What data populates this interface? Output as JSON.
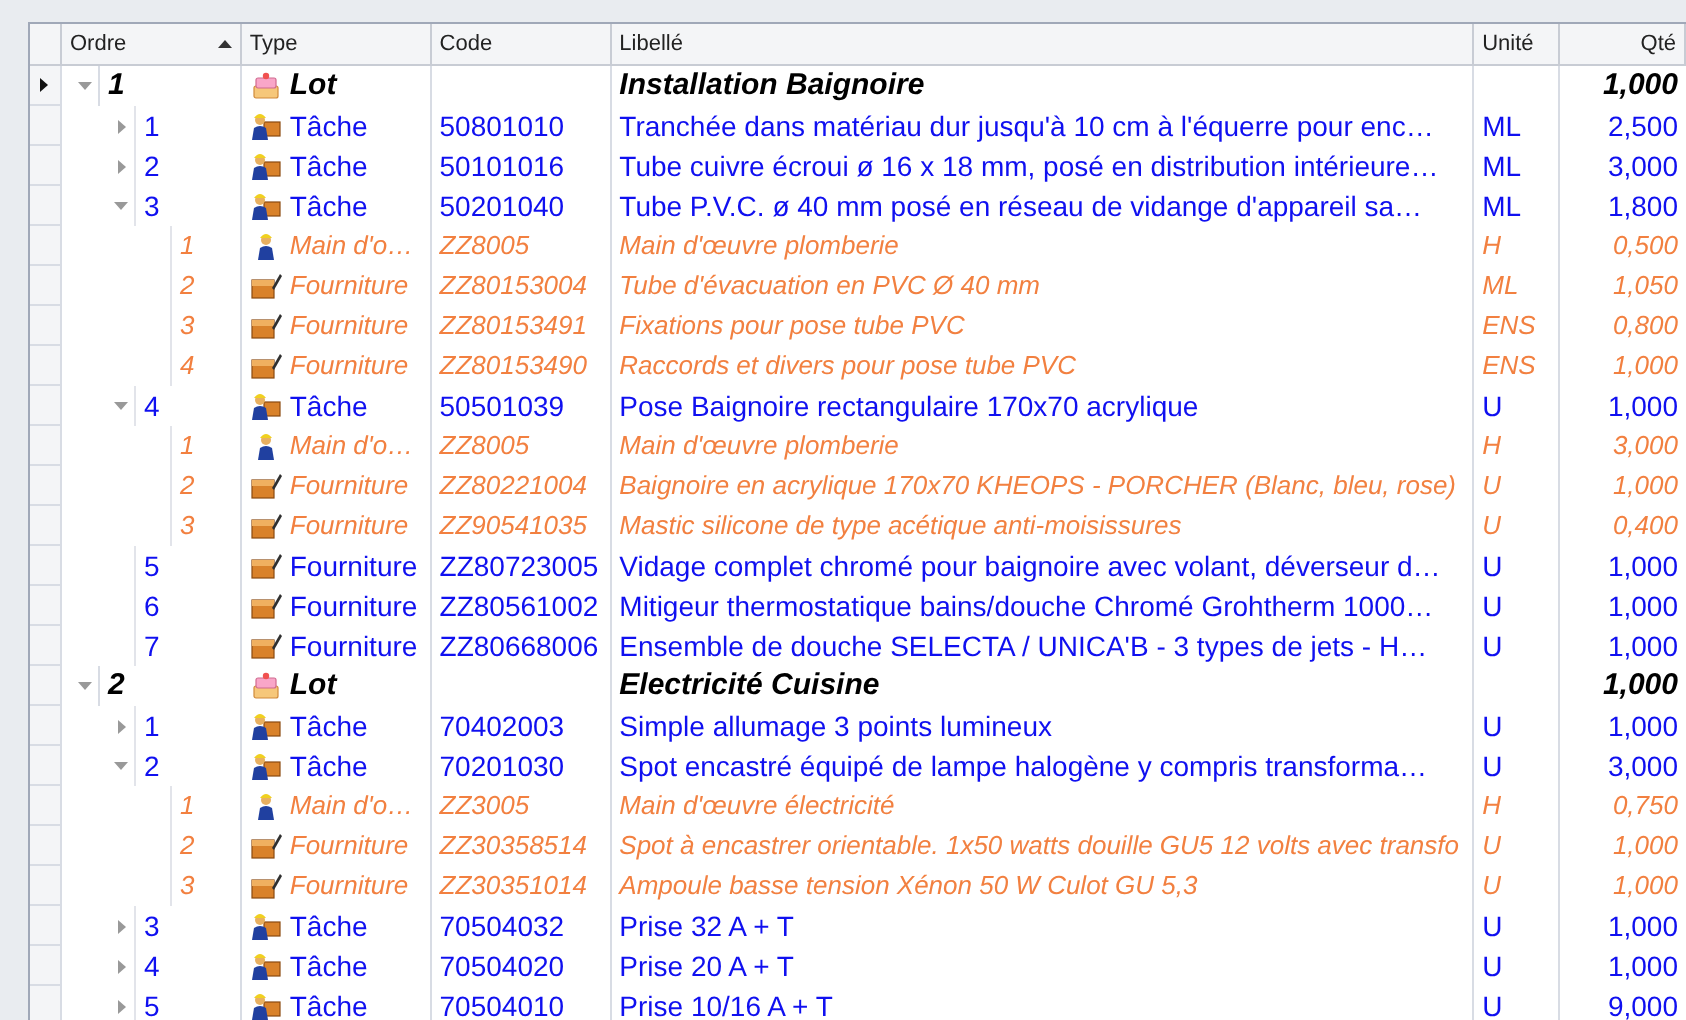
{
  "table": {
    "columns": [
      {
        "label": "Ordre",
        "sorted": true
      },
      {
        "label": "Type",
        "sorted": false
      },
      {
        "label": "Code",
        "sorted": false
      },
      {
        "label": "Libellé",
        "sorted": false
      },
      {
        "label": "Unité",
        "sorted": false
      },
      {
        "label": "Qté",
        "sorted": false
      }
    ],
    "rows": [
      {
        "order": "1",
        "kind": "lot",
        "type": "Lot",
        "label": "Installation Baignoire",
        "qty": "1,000",
        "selected": true,
        "expanded": true,
        "children": [
          {
            "order": "1",
            "kind": "task",
            "type": "Tâche",
            "code": "50801010",
            "label": "Tranchée dans matériau dur jusqu'à 10 cm à l'équerre pour enc…",
            "unit": "ML",
            "qty": "2,500",
            "selected": false,
            "expanded": false
          },
          {
            "order": "2",
            "kind": "task",
            "type": "Tâche",
            "code": "50101016",
            "label": "Tube cuivre écroui ø 16 x 18 mm, posé en distribution intérieure…",
            "unit": "ML",
            "qty": "3,000",
            "selected": false,
            "expanded": false
          },
          {
            "order": "3",
            "kind": "task",
            "type": "Tâche",
            "code": "50201040",
            "label": "Tube P.V.C. ø 40 mm posé en réseau de vidange d'appareil sa…",
            "unit": "ML",
            "qty": "1,800",
            "selected": false,
            "expanded": true,
            "children": [
              {
                "order": "1",
                "kind": "labor",
                "type": "Main d'o…",
                "code": "ZZ8005",
                "label": "Main d'œuvre plomberie",
                "unit": "H",
                "qty": "0,500",
                "selected": false
              },
              {
                "order": "2",
                "kind": "supply",
                "type": "Fourniture",
                "code": "ZZ80153004",
                "label": "Tube d'évacuation en PVC Ø 40 mm",
                "unit": "ML",
                "qty": "1,050",
                "selected": false
              },
              {
                "order": "3",
                "kind": "supply",
                "type": "Fourniture",
                "code": "ZZ80153491",
                "label": "Fixations pour pose tube PVC",
                "unit": "ENS",
                "qty": "0,800",
                "selected": false
              },
              {
                "order": "4",
                "kind": "supply",
                "type": "Fourniture",
                "code": "ZZ80153490",
                "label": "Raccords et divers pour pose tube PVC",
                "unit": "ENS",
                "qty": "1,000",
                "selected": false
              }
            ]
          },
          {
            "order": "4",
            "kind": "task",
            "type": "Tâche",
            "code": "50501039",
            "label": "Pose Baignoire rectangulaire 170x70 acrylique",
            "unit": "U",
            "qty": "1,000",
            "selected": false,
            "expanded": true,
            "children": [
              {
                "order": "1",
                "kind": "labor",
                "type": "Main d'o…",
                "code": "ZZ8005",
                "label": "Main d'œuvre plomberie",
                "unit": "H",
                "qty": "3,000",
                "selected": false
              },
              {
                "order": "2",
                "kind": "supply",
                "type": "Fourniture",
                "code": "ZZ80221004",
                "label": "Baignoire en acrylique 170x70 KHEOPS  - PORCHER (Blanc, bleu, rose)",
                "unit": "U",
                "qty": "1,000",
                "selected": false
              },
              {
                "order": "3",
                "kind": "supply",
                "type": "Fourniture",
                "code": "ZZ90541035",
                "label": "Mastic silicone de type acétique anti-moisissures",
                "unit": "U",
                "qty": "0,400",
                "selected": false
              }
            ]
          },
          {
            "order": "5",
            "kind": "supply",
            "type": "Fourniture",
            "code": "ZZ80723005",
            "label": "Vidage complet chromé pour baignoire avec volant, déverseur d…",
            "unit": "U",
            "qty": "1,000",
            "selected": false
          },
          {
            "order": "6",
            "kind": "supply",
            "type": "Fourniture",
            "code": "ZZ80561002",
            "label": "Mitigeur thermostatique bains/douche Chromé Grohtherm 1000…",
            "unit": "U",
            "qty": "1,000",
            "selected": false
          },
          {
            "order": "7",
            "kind": "supply",
            "type": "Fourniture",
            "code": "ZZ80668006",
            "label": "Ensemble de douche SELECTA / UNICA'B  - 3 types de jets - H…",
            "unit": "U",
            "qty": "1,000",
            "selected": false
          }
        ]
      },
      {
        "order": "2",
        "kind": "lot",
        "type": "Lot",
        "label": "Electricité Cuisine",
        "qty": "1,000",
        "selected": false,
        "expanded": true,
        "children": [
          {
            "order": "1",
            "kind": "task",
            "type": "Tâche",
            "code": "70402003",
            "label": "Simple allumage 3 points lumineux",
            "unit": "U",
            "qty": "1,000",
            "selected": false,
            "expanded": false
          },
          {
            "order": "2",
            "kind": "task",
            "type": "Tâche",
            "code": "70201030",
            "label": "Spot encastré équipé de lampe halogène y compris transforma…",
            "unit": "U",
            "qty": "3,000",
            "selected": false,
            "expanded": true,
            "children": [
              {
                "order": "1",
                "kind": "labor",
                "type": "Main d'o…",
                "code": "ZZ3005",
                "label": "Main d'œuvre électricité",
                "unit": "H",
                "qty": "0,750",
                "selected": false
              },
              {
                "order": "2",
                "kind": "supply",
                "type": "Fourniture",
                "code": "ZZ30358514",
                "label": "Spot à encastrer orientable. 1x50 watts douille GU5 12 volts avec transfo",
                "unit": "U",
                "qty": "1,000",
                "selected": false
              },
              {
                "order": "3",
                "kind": "supply",
                "type": "Fourniture",
                "code": "ZZ30351014",
                "label": "Ampoule basse tension Xénon 50 W Culot GU 5,3",
                "unit": "U",
                "qty": "1,000",
                "selected": false
              }
            ]
          },
          {
            "order": "3",
            "kind": "task",
            "type": "Tâche",
            "code": "70504032",
            "label": "Prise 32 A + T",
            "unit": "U",
            "qty": "1,000",
            "selected": false,
            "expanded": false
          },
          {
            "order": "4",
            "kind": "task",
            "type": "Tâche",
            "code": "70504020",
            "label": "Prise 20 A + T",
            "unit": "U",
            "qty": "1,000",
            "selected": false,
            "expanded": false
          },
          {
            "order": "5",
            "kind": "task",
            "type": "Tâche",
            "code": "70504010",
            "label": "Prise 10/16 A + T",
            "unit": "U",
            "qty": "9,000",
            "selected": false,
            "expanded": false
          }
        ]
      }
    ]
  }
}
